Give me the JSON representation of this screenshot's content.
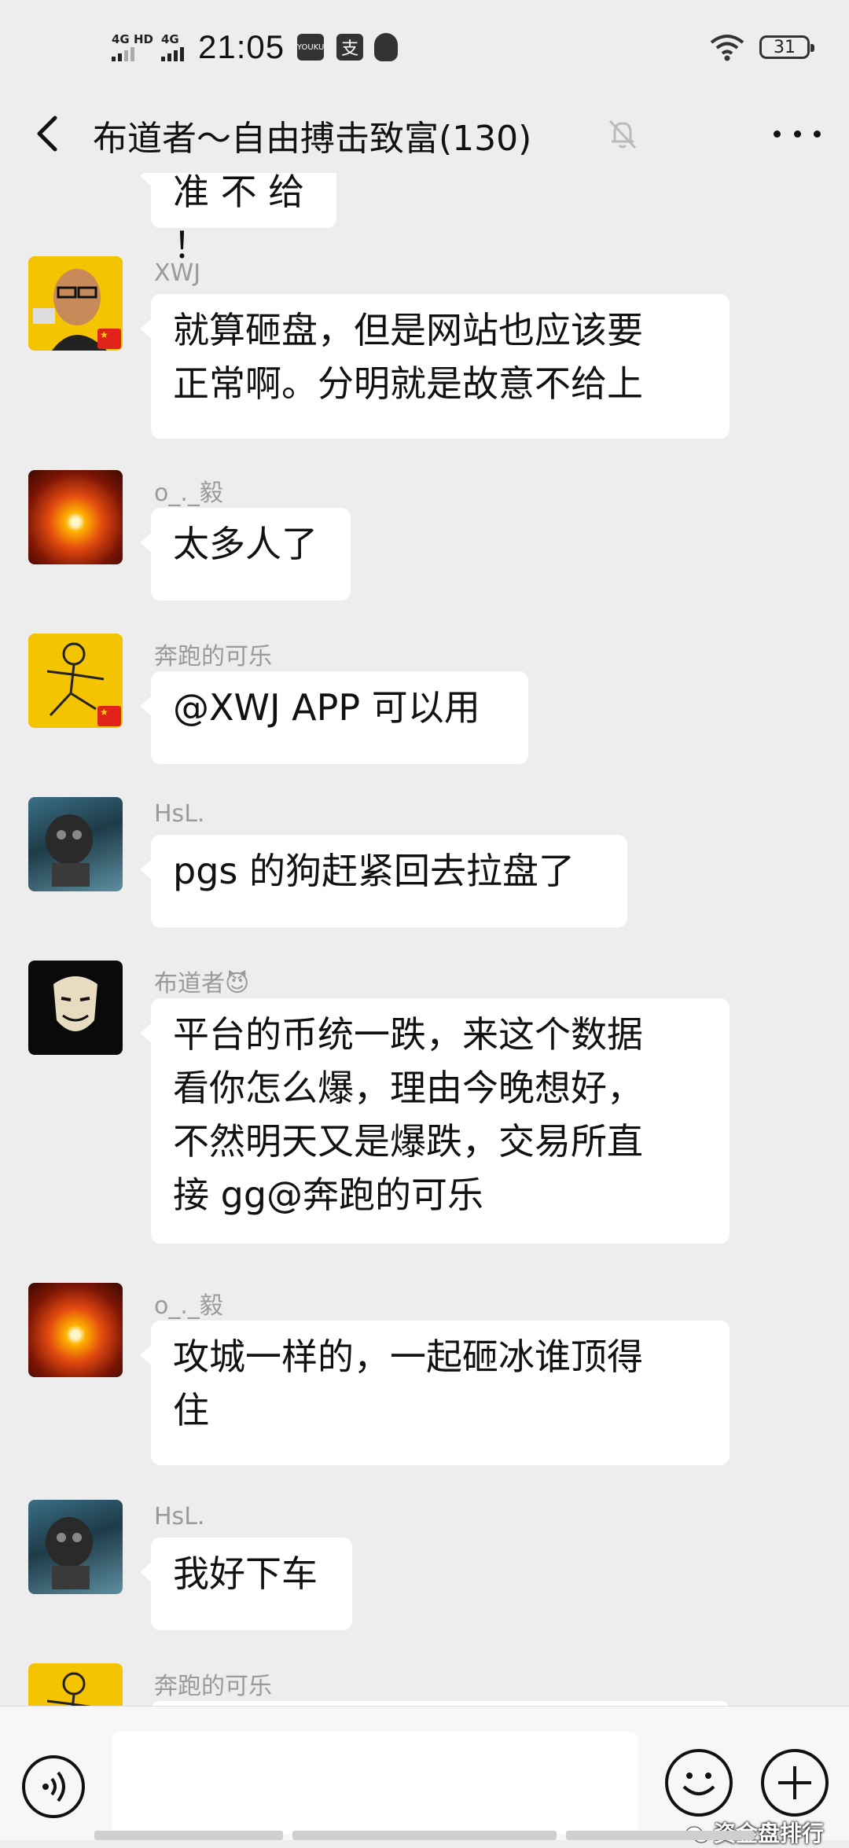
{
  "status_bar": {
    "signal1_label": "4G HD",
    "signal2_label": "4G",
    "time": "21:05",
    "app_icon_text": "YOUKU",
    "battery_level": "31"
  },
  "nav": {
    "title": "布道者～自由搏击致富(130)"
  },
  "messages": [
    {
      "sender": "",
      "text": "准 不 给 ！"
    },
    {
      "sender": "XWJ",
      "lines": [
        "就算砸盘，但是网站也应该要",
        "正常啊。分明就是故意不给上"
      ]
    },
    {
      "sender": "o_._毅",
      "text": "太多人了"
    },
    {
      "sender": "奔跑的可乐",
      "text": "@XWJ APP 可以用"
    },
    {
      "sender": "HsL.",
      "text": "pgs 的狗赶紧回去拉盘了"
    },
    {
      "sender": "布道者😈",
      "lines": [
        "平台的币统一跌，来这个数据",
        "看你怎么爆，理由今晚想好，",
        "不然明天又是爆跌，交易所直",
        "接 gg@奔跑的可乐"
      ]
    },
    {
      "sender": "o_._毅",
      "lines": [
        "攻城一样的，一起砸冰谁顶得",
        "住"
      ]
    },
    {
      "sender": "HsL.",
      "text": "我好下车"
    },
    {
      "sender": "奔跑的可乐",
      "text": ""
    }
  ],
  "watermark": "资金盘排行",
  "icons": {
    "back": "chevron-left-icon",
    "mute": "bell-off-icon",
    "more": "more-dots-icon",
    "voice": "voice-icon",
    "emoji": "emoji-icon",
    "plus": "plus-icon"
  }
}
